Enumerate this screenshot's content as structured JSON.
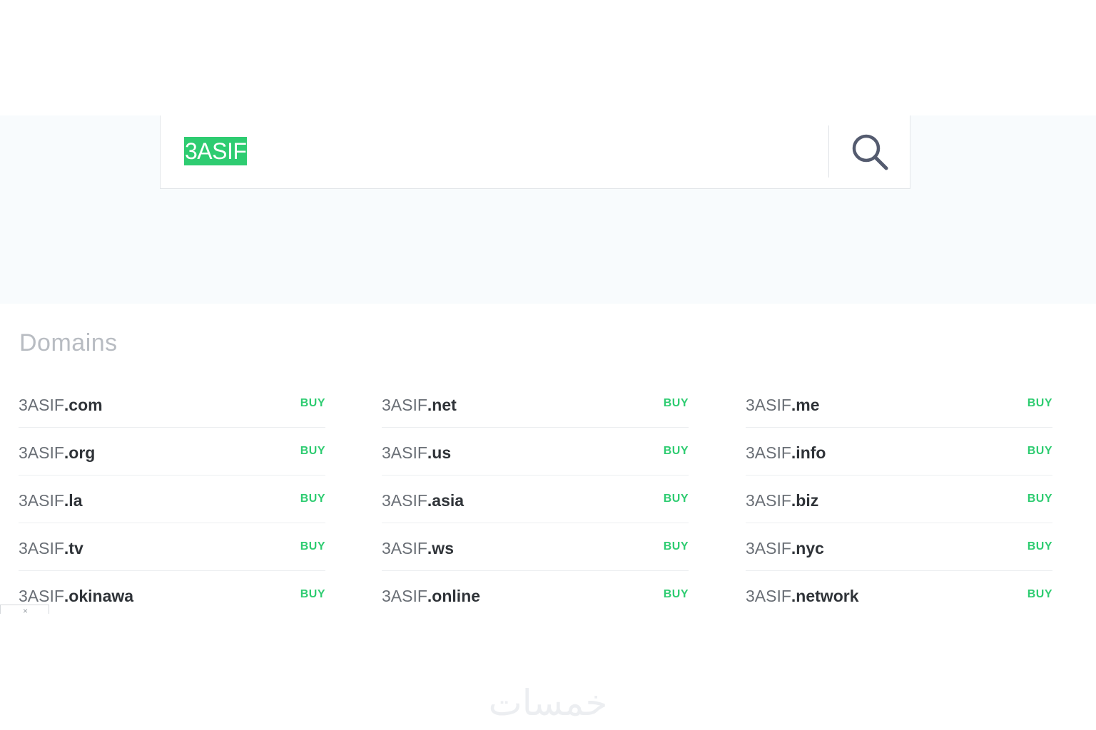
{
  "search": {
    "value": "3ASIF"
  },
  "section_title": "Domains",
  "columns": [
    [
      {
        "base": "3ASIF",
        "tld": ".com",
        "action": "BUY"
      },
      {
        "base": "3ASIF",
        "tld": ".org",
        "action": "BUY"
      },
      {
        "base": "3ASIF",
        "tld": ".la",
        "action": "BUY"
      },
      {
        "base": "3ASIF",
        "tld": ".tv",
        "action": "BUY"
      },
      {
        "base": "3ASIF",
        "tld": ".okinawa",
        "action": "BUY"
      }
    ],
    [
      {
        "base": "3ASIF",
        "tld": ".net",
        "action": "BUY"
      },
      {
        "base": "3ASIF",
        "tld": ".us",
        "action": "BUY"
      },
      {
        "base": "3ASIF",
        "tld": ".asia",
        "action": "BUY"
      },
      {
        "base": "3ASIF",
        "tld": ".ws",
        "action": "BUY"
      },
      {
        "base": "3ASIF",
        "tld": ".online",
        "action": "BUY"
      }
    ],
    [
      {
        "base": "3ASIF",
        "tld": ".me",
        "action": "BUY"
      },
      {
        "base": "3ASIF",
        "tld": ".info",
        "action": "BUY"
      },
      {
        "base": "3ASIF",
        "tld": ".biz",
        "action": "BUY"
      },
      {
        "base": "3ASIF",
        "tld": ".nyc",
        "action": "BUY"
      },
      {
        "base": "3ASIF",
        "tld": ".network",
        "action": "BUY"
      }
    ]
  ],
  "mini_tab": {
    "close_glyph": "×"
  },
  "watermark": "خمسات",
  "colors": {
    "accent": "#2ecc71",
    "hero_bg": "#f8fbfd",
    "title": "#b8bcc2",
    "domain_base": "#6a6f76",
    "domain_tld": "#2f3338"
  },
  "icons": {
    "search": "search-icon"
  }
}
